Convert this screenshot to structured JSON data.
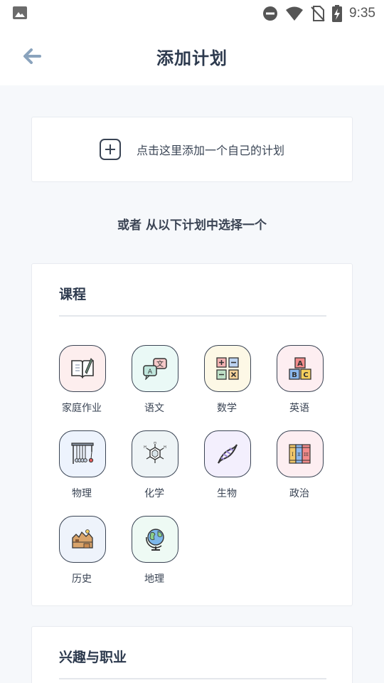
{
  "status_bar": {
    "time": "9:35",
    "icons": [
      "image-icon",
      "do-not-disturb-icon",
      "wifi-icon",
      "no-sim-icon",
      "battery-charging-icon"
    ]
  },
  "header": {
    "back_icon": "arrow-left-icon",
    "title": "添加计划"
  },
  "add_plan": {
    "icon": "plus-square-icon",
    "label": "点击这里添加一个自己的计划"
  },
  "or_text": "或者 从以下计划中选择一个",
  "sections": [
    {
      "title": "课程",
      "items": [
        {
          "label": "家庭作业",
          "icon": "homework-book-icon",
          "color": "#fdeeee"
        },
        {
          "label": "语文",
          "icon": "language-chat-icon",
          "color": "#eaf9f6"
        },
        {
          "label": "数学",
          "icon": "math-symbols-icon",
          "color": "#fdf8e6"
        },
        {
          "label": "英语",
          "icon": "abc-blocks-icon",
          "color": "#fdeef1"
        },
        {
          "label": "物理",
          "icon": "newtons-cradle-icon",
          "color": "#edf3fd"
        },
        {
          "label": "化学",
          "icon": "molecule-icon",
          "color": "#eef4f6"
        },
        {
          "label": "生物",
          "icon": "dna-icon",
          "color": "#f3effd"
        },
        {
          "label": "政治",
          "icon": "law-books-icon",
          "color": "#fdeef1"
        },
        {
          "label": "历史",
          "icon": "history-landscape-icon",
          "color": "#eef3fb"
        },
        {
          "label": "地理",
          "icon": "globe-icon",
          "color": "#eefaf4"
        }
      ]
    },
    {
      "title": "兴趣与职业",
      "items": []
    }
  ]
}
